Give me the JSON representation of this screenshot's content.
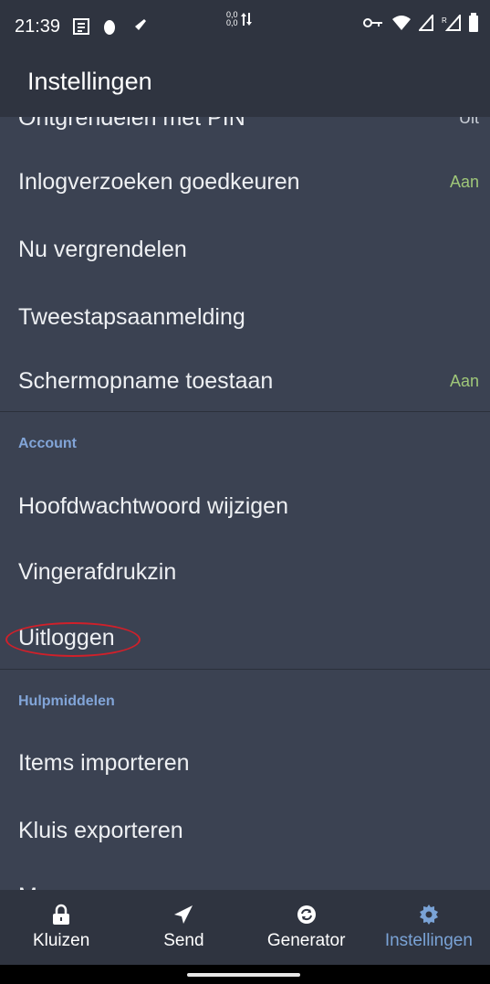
{
  "status": {
    "time": "21:39",
    "net_up": "0,0",
    "net_down": "0,0"
  },
  "appbar": {
    "title": "Instellingen"
  },
  "rows": [
    {
      "label": "Ontgrendelen met PIN",
      "value": "Uit"
    },
    {
      "label": "Inlogverzoeken goedkeuren",
      "value": "Aan"
    },
    {
      "label": "Nu vergrendelen",
      "value": ""
    },
    {
      "label": "Tweestapsaanmelding",
      "value": ""
    },
    {
      "label": "Schermopname toestaan",
      "value": "Aan"
    }
  ],
  "sections": {
    "account": {
      "header": "Account",
      "items": [
        "Hoofdwachtwoord wijzigen",
        "Vingerafdrukzin",
        "Uitloggen"
      ]
    },
    "tools": {
      "header": "Hulpmiddelen",
      "items": [
        "Items importeren",
        "Kluis exporteren"
      ]
    }
  },
  "nav": {
    "items": [
      {
        "label": "Kluizen",
        "icon": "lock-icon"
      },
      {
        "label": "Send",
        "icon": "send-icon"
      },
      {
        "label": "Generator",
        "icon": "refresh-icon"
      },
      {
        "label": "Instellingen",
        "icon": "gear-icon"
      }
    ]
  },
  "colors": {
    "background": "#3b4252",
    "bar": "#2f3440",
    "accent": "#7aa3d6",
    "on_value": "#9fc779",
    "annotation": "#d0202a"
  }
}
